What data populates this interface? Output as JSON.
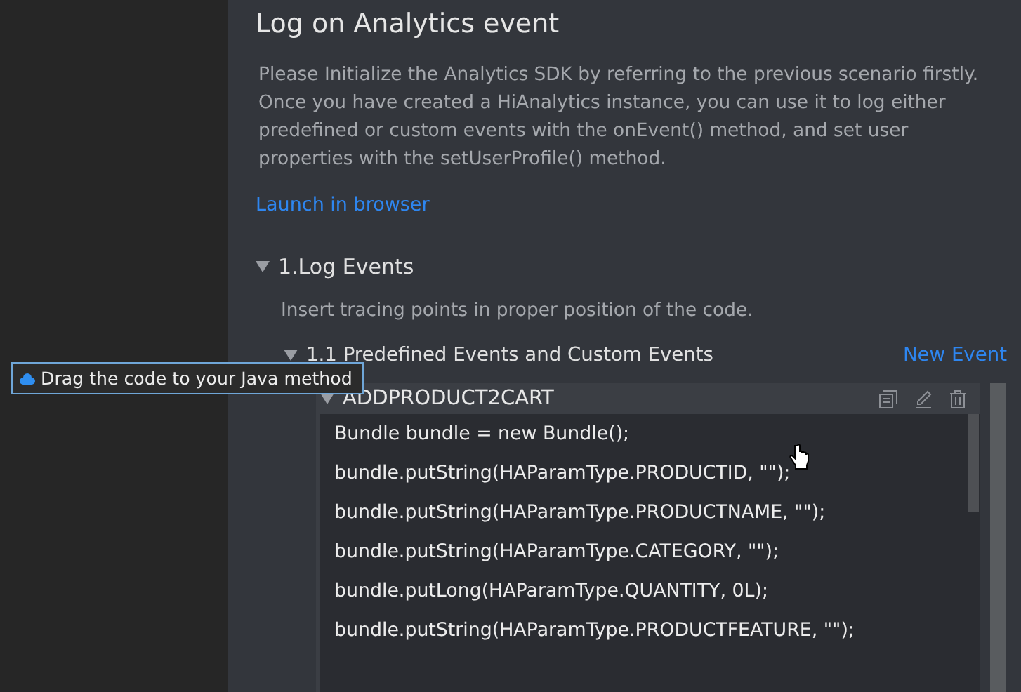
{
  "title": "Log on Analytics event",
  "description": "Please Initialize the Analytics SDK by referring to the previous scenario firstly. Once you have created a HiAnalytics instance, you can use it to log either predefined or custom events with the onEvent() method, and set user properties with the setUserProfile() method.",
  "launch_link": "Launch in browser",
  "section": {
    "title": "1.Log Events",
    "expanded": true,
    "description": "Insert tracing points in proper position of the code.",
    "subsection": {
      "title": "1.1 Predefined Events and Custom Events",
      "expanded": true,
      "action": "New Event",
      "event": {
        "name": "ADDPRODUCT2CART",
        "expanded": true,
        "code_lines": [
          "Bundle bundle = new Bundle();",
          "bundle.putString(HAParamType.PRODUCTID, \"\");",
          "bundle.putString(HAParamType.PRODUCTNAME, \"\");",
          "bundle.putString(HAParamType.CATEGORY, \"\");",
          "bundle.putLong(HAParamType.QUANTITY, 0L);",
          "bundle.putString(HAParamType.PRODUCTFEATURE, \"\");"
        ]
      }
    }
  },
  "tooltip": "Drag the code to your Java method"
}
